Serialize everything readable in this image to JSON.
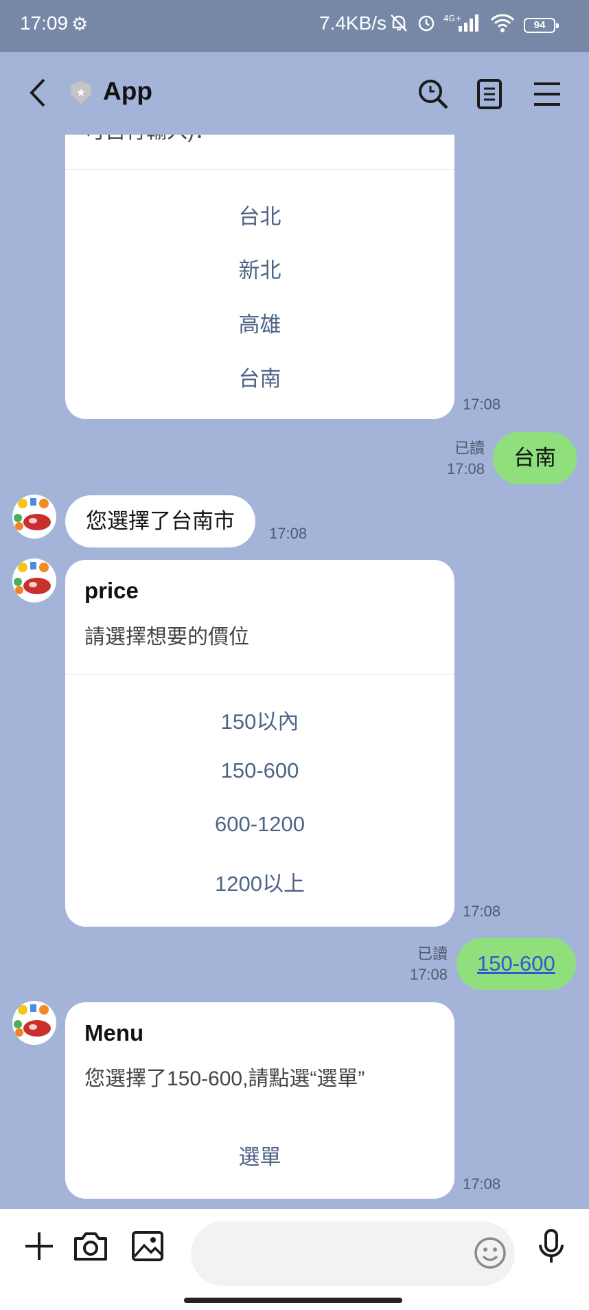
{
  "status_bar": {
    "time": "17:09",
    "net_speed": "7.4KB/s",
    "network": "4G+",
    "battery": "94"
  },
  "header": {
    "title": "App"
  },
  "chat": {
    "card_city": {
      "partial_text": "可自行輸入)：",
      "options": [
        "台北",
        "新北",
        "高雄",
        "台南"
      ],
      "time": "17:08"
    },
    "msg_out_1": {
      "read_label": "已讀",
      "time": "17:08",
      "text": "台南"
    },
    "msg_in_1": {
      "text": "您選擇了台南市",
      "time": "17:08"
    },
    "card_price": {
      "title": "price",
      "text": "請選擇想要的價位",
      "options": [
        "150以內",
        "150-600",
        "600-1200",
        "1200以上"
      ],
      "time": "17:08"
    },
    "msg_out_2": {
      "read_label": "已讀",
      "time": "17:08",
      "text": "150-600"
    },
    "card_menu": {
      "title": "Menu",
      "text": "您選擇了150-600,請點選“選單”",
      "options": [
        "選單"
      ],
      "time": "17:08"
    }
  },
  "input_bar": {
    "placeholder": ""
  }
}
